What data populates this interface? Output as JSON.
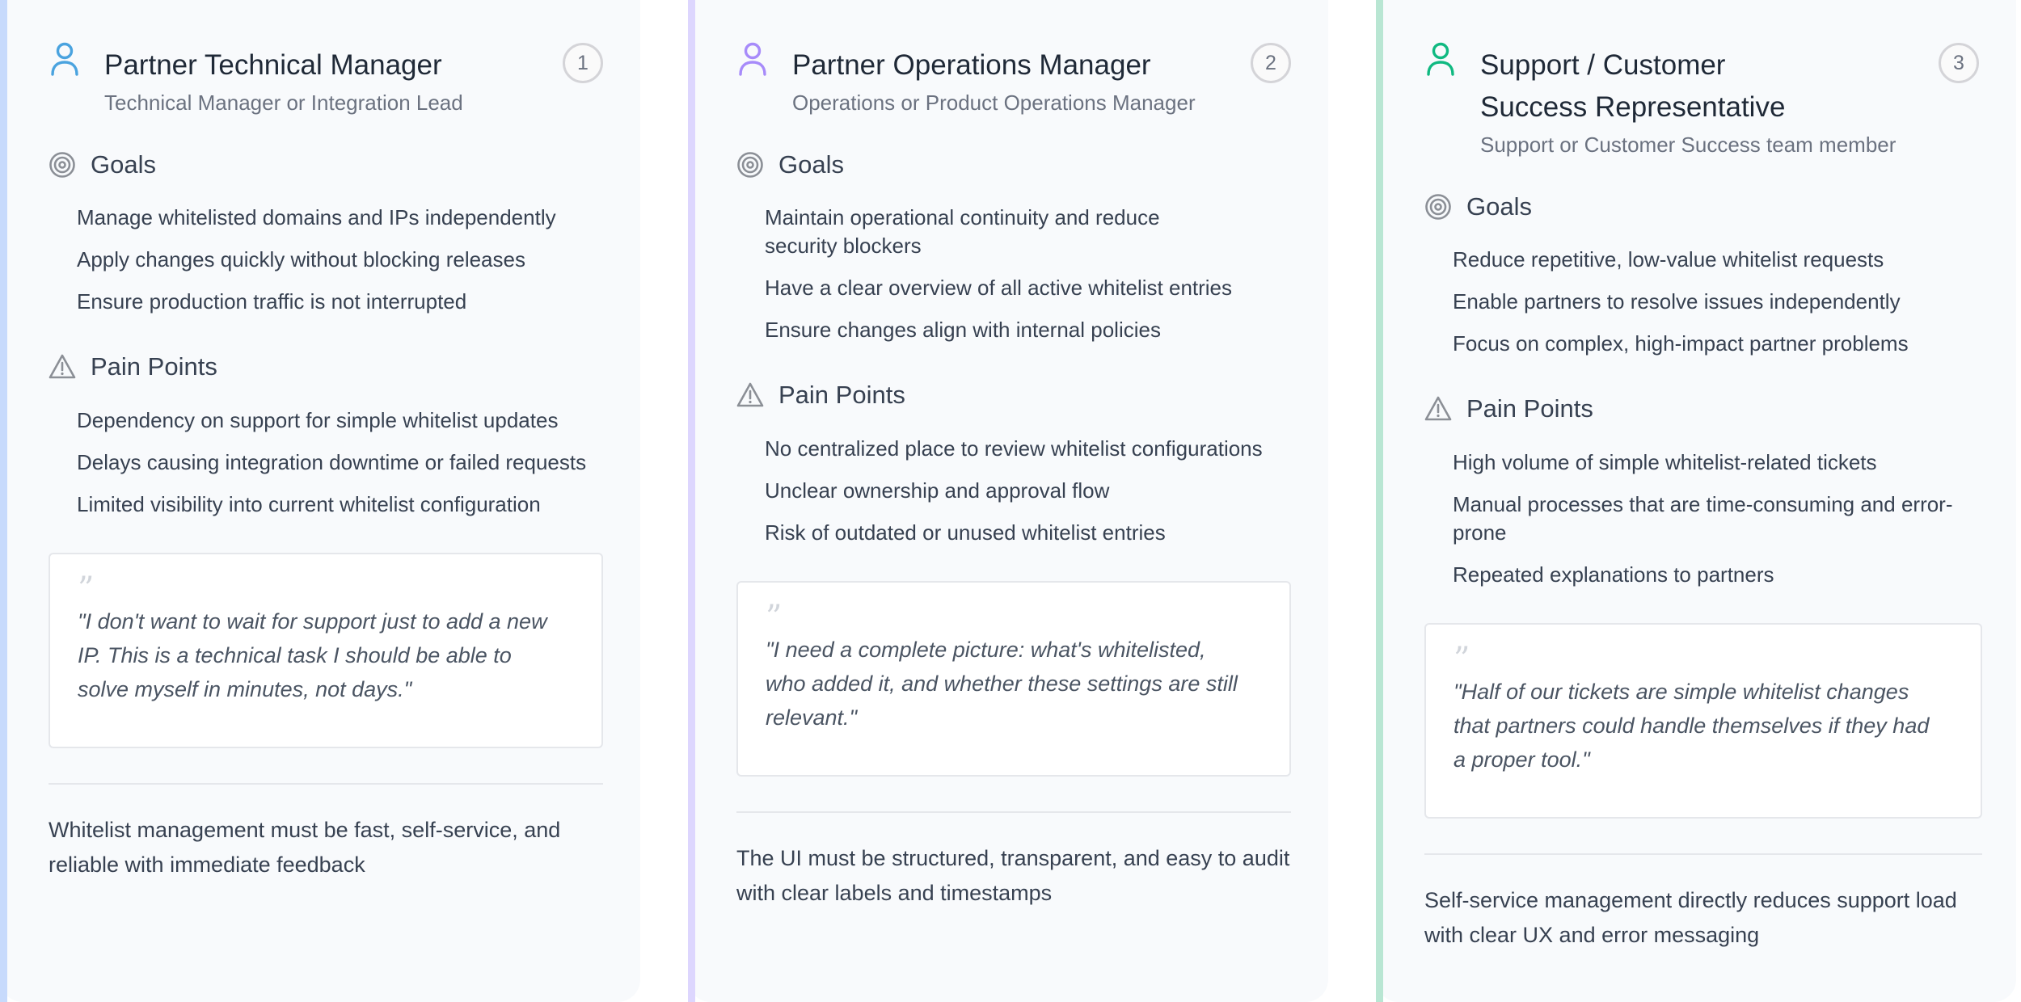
{
  "personas": [
    {
      "number": "1",
      "title": "Partner Technical Manager",
      "subtitle": "Technical Manager or Integration Lead",
      "icon": "person-icon",
      "accent": "#4aa3df",
      "goals_label": "Goals",
      "goals": [
        "Manage whitelisted domains and IPs independently",
        "Apply changes quickly without blocking releases",
        "Ensure production traffic is not interrupted"
      ],
      "pain_label": "Pain Points",
      "pain_points": [
        "Dependency on support for simple whitelist updates",
        "Delays causing integration downtime or failed requests",
        "Limited visibility into current whitelist configuration"
      ],
      "quote": "\"I don't want to wait for support just to add a new IP. This is a technical task I should be able to solve myself in minutes, not days.\"",
      "summary": "Whitelist management must be fast, self-service, and reliable with immediate feedback"
    },
    {
      "number": "2",
      "title": "Partner Operations Manager",
      "subtitle": "Operations or Product Operations Manager",
      "icon": "person-icon",
      "accent": "#a78bfa",
      "goals_label": "Goals",
      "goals": [
        "Maintain operational continuity and reduce security blockers",
        "Have a clear overview of all active whitelist entries",
        "Ensure changes align with internal policies"
      ],
      "pain_label": "Pain Points",
      "pain_points": [
        "No centralized place to review whitelist configurations",
        "Unclear ownership and approval flow",
        "Risk of outdated or unused whitelist entries"
      ],
      "quote": "\"I need a complete picture: what's whitelisted, who added it, and whether these settings are still relevant.\"",
      "summary": "The UI must be structured, transparent, and easy to audit with clear labels and timestamps"
    },
    {
      "number": "3",
      "title": "Support / Customer Success Representative",
      "subtitle": "Support or Customer Success team member",
      "icon": "person-icon",
      "accent": "#10b981",
      "goals_label": "Goals",
      "goals": [
        "Reduce repetitive, low-value whitelist requests",
        "Enable partners to resolve issues independently",
        "Focus on complex, high-impact partner problems"
      ],
      "pain_label": "Pain Points",
      "pain_points": [
        "High volume of simple whitelist-related tickets",
        "Manual processes that are time-consuming and error-prone",
        "Repeated explanations to partners"
      ],
      "quote": "\"Half of our tickets are simple whitelist changes that partners could handle themselves if they had a proper tool.\"",
      "summary": "Self-service management directly reduces support load with clear UX and error messaging"
    }
  ]
}
